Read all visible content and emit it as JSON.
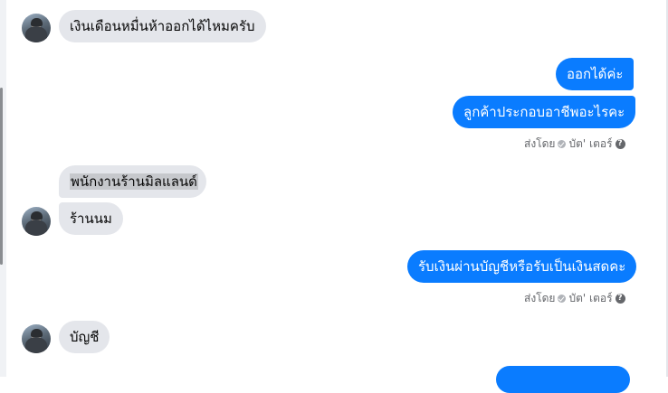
{
  "messages": [
    {
      "dir": "in",
      "text": "เงินเดือนหมื่นห้าออกได้ไหมครับ"
    },
    {
      "dir": "out",
      "text": "ออกได้ค่ะ"
    },
    {
      "dir": "out",
      "text": "ลูกค้าประกอบอาชีพอะไรคะ"
    },
    {
      "dir": "in",
      "text": "พนักงานร้านมิลแลนด์"
    },
    {
      "dir": "in",
      "text": "ร้านนม"
    },
    {
      "dir": "out",
      "text": "รับเงินผ่านบัญชีหรือรับเป็นเงินสดคะ"
    },
    {
      "dir": "in",
      "text": "บัญชี"
    }
  ],
  "receipt": {
    "sent_by_label": "ส่งโดย",
    "sender_name": "บัต' เตอร์",
    "help_glyph": "?"
  },
  "icons": {
    "avatar": "user-avatar",
    "check": "sent-check-icon",
    "help": "help-circle-icon"
  },
  "colors": {
    "outgoing_bubble": "#0a7cff",
    "incoming_bubble": "#e4e6eb",
    "receipt_text": "#65676b"
  }
}
